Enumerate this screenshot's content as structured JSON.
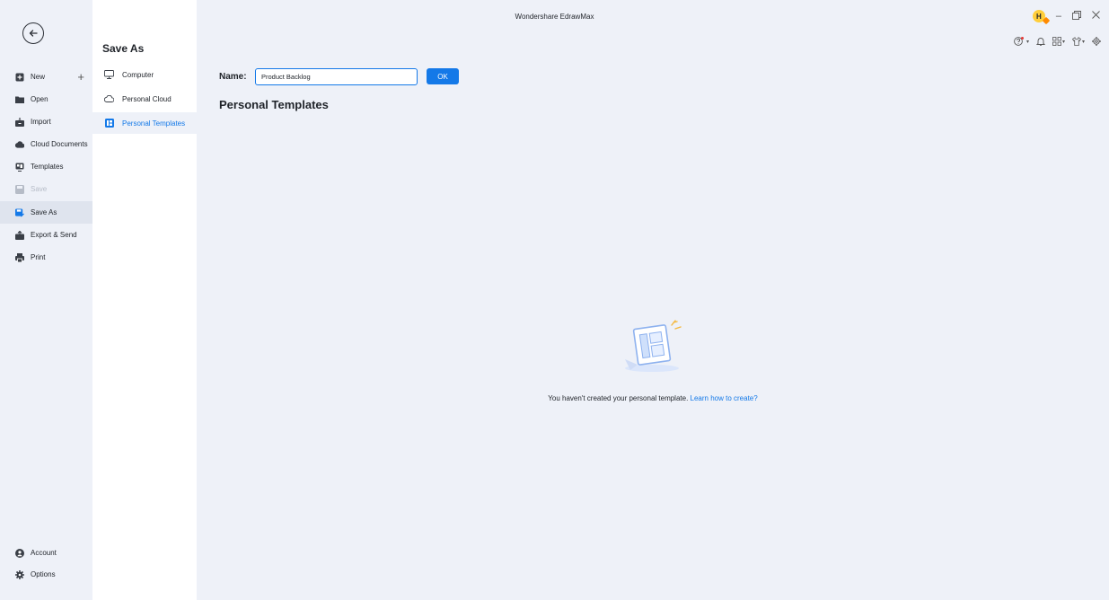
{
  "app": {
    "title": "Wondershare EdrawMax"
  },
  "user": {
    "avatar_initial": "H"
  },
  "leftnav": {
    "items": [
      {
        "label": "New",
        "icon": "new-icon"
      },
      {
        "label": "Open",
        "icon": "folder-icon"
      },
      {
        "label": "Import",
        "icon": "import-icon"
      },
      {
        "label": "Cloud Documents",
        "icon": "cloud-icon"
      },
      {
        "label": "Templates",
        "icon": "templates-icon"
      },
      {
        "label": "Save",
        "icon": "save-icon",
        "disabled": true
      },
      {
        "label": "Save As",
        "icon": "save-as-icon",
        "active": true
      },
      {
        "label": "Export & Send",
        "icon": "export-icon"
      },
      {
        "label": "Print",
        "icon": "print-icon"
      }
    ],
    "bottom": [
      {
        "label": "Account",
        "icon": "account-icon"
      },
      {
        "label": "Options",
        "icon": "gear-icon"
      }
    ]
  },
  "saveas": {
    "title": "Save As",
    "items": [
      {
        "label": "Computer",
        "icon": "monitor-icon"
      },
      {
        "label": "Personal Cloud",
        "icon": "cloud-outline-icon"
      },
      {
        "label": "Personal Templates",
        "icon": "template-icon",
        "active": true
      }
    ]
  },
  "main": {
    "name_label": "Name:",
    "name_value": "Product Backlog",
    "ok_label": "OK",
    "section_title": "Personal Templates",
    "empty_message": "You haven't created your personal template.",
    "empty_link": "Learn how to create?"
  },
  "colors": {
    "accent": "#1479e8",
    "background": "#eef1f8",
    "panel": "#ffffff"
  }
}
